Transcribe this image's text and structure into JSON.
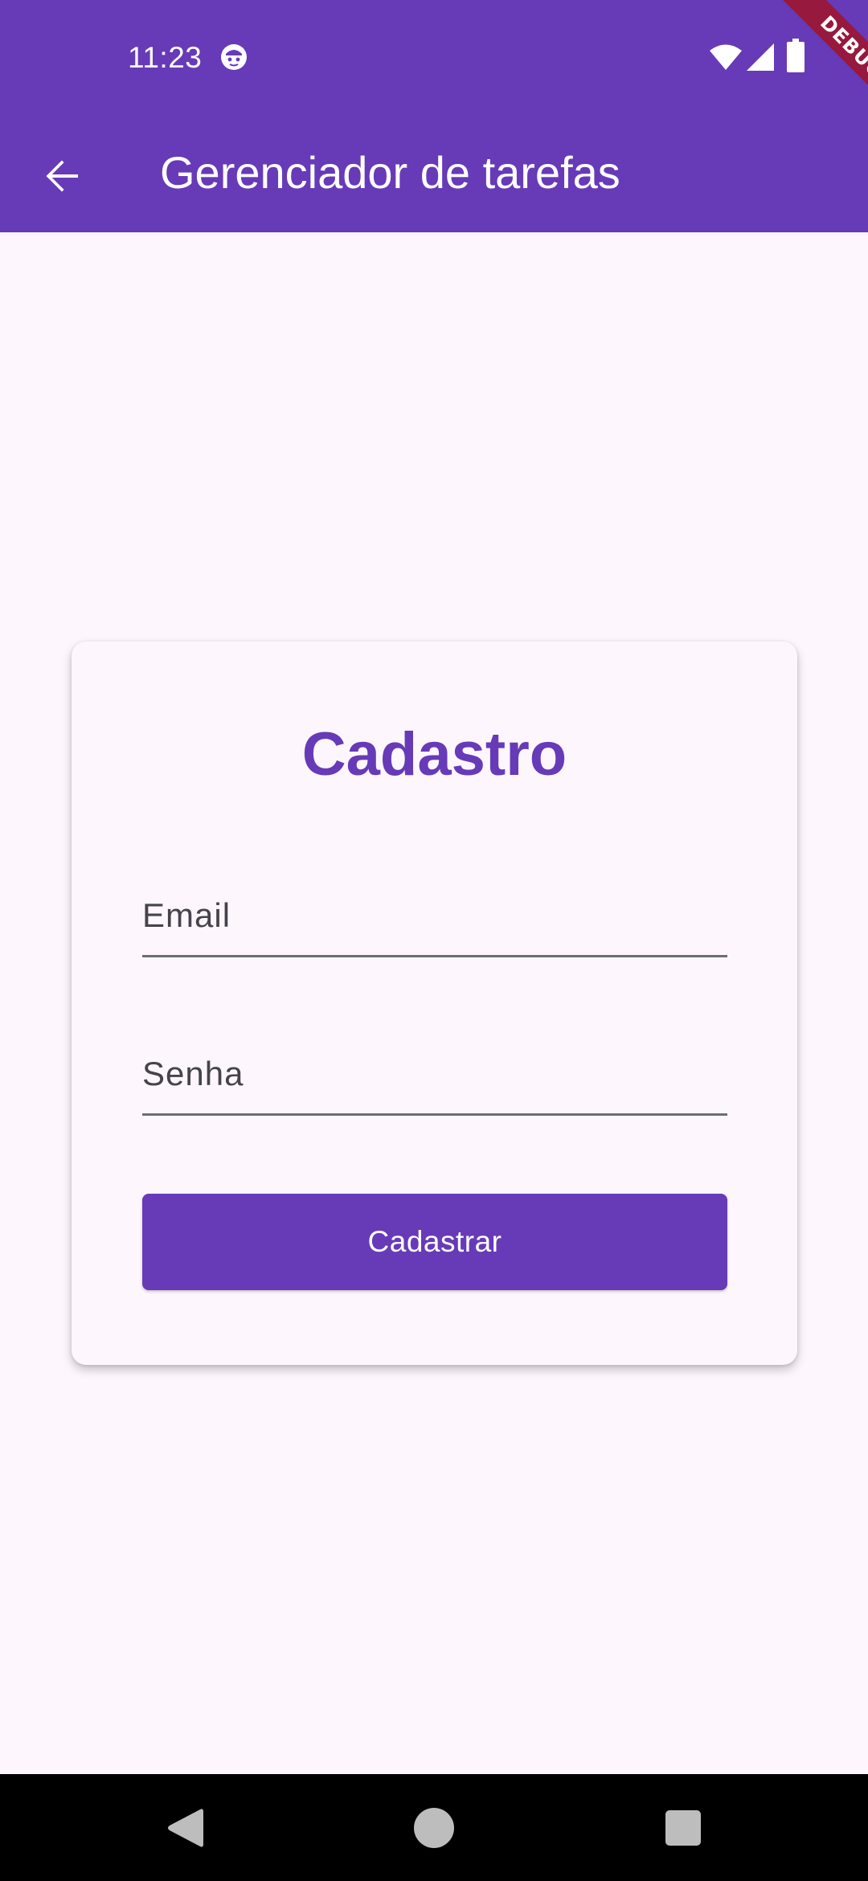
{
  "status_bar": {
    "time": "11:23",
    "icons": [
      "app-notification-icon",
      "wifi-icon",
      "cellular-signal-icon",
      "battery-icon"
    ]
  },
  "debug_banner": {
    "label": "DEBUG"
  },
  "app_bar": {
    "title": "Gerenciador de tarefas",
    "back_icon": "arrow-back-icon"
  },
  "form": {
    "title": "Cadastro",
    "email": {
      "placeholder": "Email",
      "value": ""
    },
    "password": {
      "placeholder": "Senha",
      "value": ""
    },
    "submit_label": "Cadastrar"
  },
  "nav_bar": {
    "icons": [
      "nav-back-icon",
      "nav-home-icon",
      "nav-recents-icon"
    ]
  },
  "colors": {
    "primary": "#673AB7",
    "background": "#FDF7FD",
    "on_primary": "#FFFFFF",
    "input_text": "#46434C",
    "underline": "#6F6C74",
    "nav_background": "#000000",
    "nav_icon": "#BDBDBD",
    "debug_banner": "#A01428"
  }
}
